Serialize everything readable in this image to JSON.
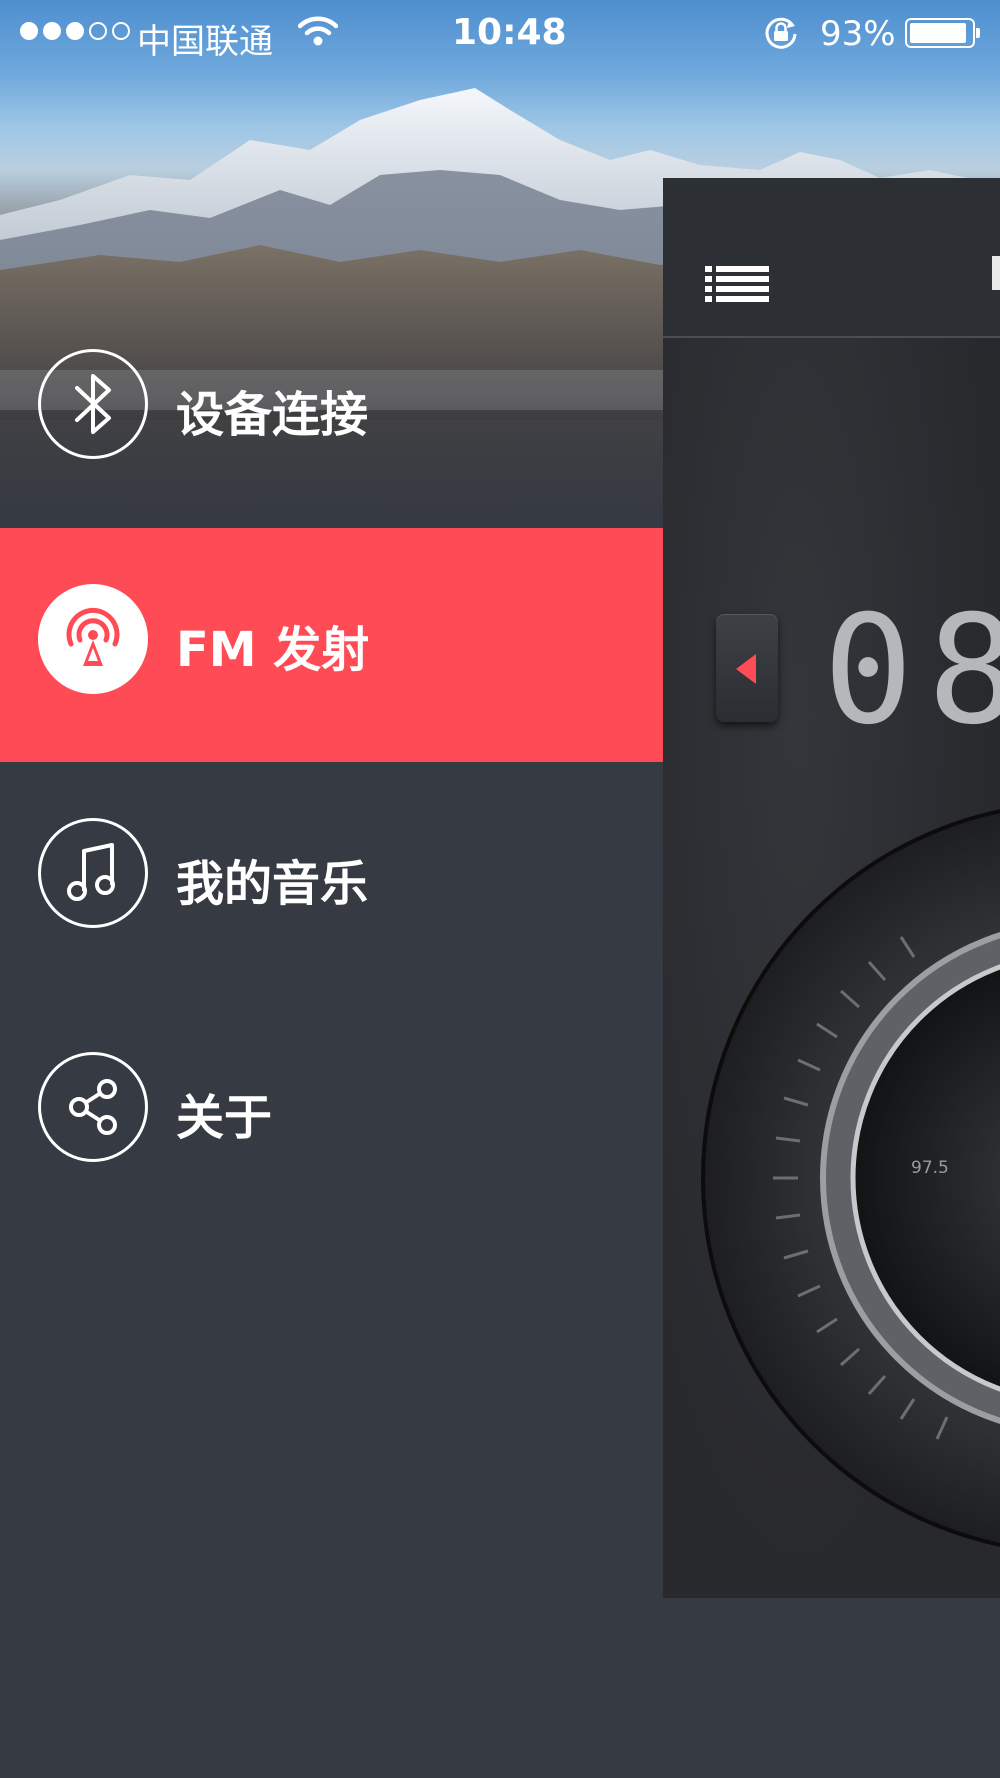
{
  "status_bar": {
    "carrier": "中国联通",
    "time": "10:48",
    "battery_percent": "93%",
    "battery_level": 0.93,
    "signal_dots": [
      true,
      true,
      true,
      false,
      false
    ]
  },
  "menu": {
    "items": [
      {
        "label": "设备连接",
        "icon": "bluetooth-icon",
        "active": false
      },
      {
        "label": "FM 发射",
        "icon": "radio-tower-icon",
        "active": true
      },
      {
        "label": "我的音乐",
        "icon": "music-note-icon",
        "active": false
      },
      {
        "label": "关于",
        "icon": "share-icon",
        "active": false
      }
    ]
  },
  "main_panel": {
    "frequency_display": "08",
    "dial_label": "97.5"
  },
  "colors": {
    "accent": "#ff4b55",
    "menu_background": "#363a42",
    "panel_background": "#2a2c30"
  }
}
